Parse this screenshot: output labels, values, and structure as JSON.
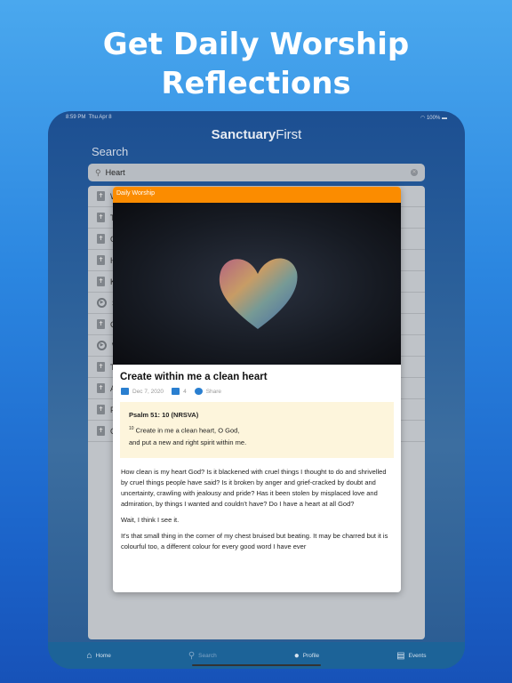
{
  "headline": {
    "line1": "Get Daily Worship",
    "line2": "Reflections"
  },
  "status": {
    "time": "8:59 PM",
    "date": "Thu Apr 8",
    "battery": "100%"
  },
  "app": {
    "logo_bold": "Sanctuary",
    "logo_light": "First"
  },
  "search": {
    "title": "Search",
    "value": "Heart"
  },
  "results": [
    {
      "icon": "bible-icon",
      "letter": "W"
    },
    {
      "icon": "bible-icon",
      "letter": "T"
    },
    {
      "icon": "bible-icon",
      "letter": "G"
    },
    {
      "icon": "bible-icon",
      "letter": "H"
    },
    {
      "icon": "bible-icon",
      "letter": "K"
    },
    {
      "icon": "play-icon",
      "letter": "S"
    },
    {
      "icon": "bible-icon",
      "letter": "C"
    },
    {
      "icon": "play-icon",
      "letter": "W"
    },
    {
      "icon": "bible-icon",
      "letter": "T"
    },
    {
      "icon": "bible-icon",
      "letter": "A"
    },
    {
      "icon": "bible-icon",
      "letter": "F"
    },
    {
      "icon": "bible-icon",
      "letter": "C"
    }
  ],
  "card": {
    "category": "Daily Worship",
    "category_color": "#fb8c00",
    "title": "Create within me a clean heart",
    "date": "Dec 7, 2020",
    "comments": "4",
    "share": "Share",
    "verse": {
      "ref": "Psalm 51: 10 (NRSVA)",
      "num": "10",
      "line1": "Create in me a clean heart, O God,",
      "line2": "and put a new and right spirit within me."
    },
    "paragraphs": [
      "How clean is my heart God? Is it blackened with cruel things I thought to do and shrivelled by cruel things people have said? Is it broken by anger and grief-cracked by doubt and uncertainty, crawling with jealousy and pride? Has it been stolen by misplaced love and admiration, by things I wanted and couldn't have? Do I have a heart at all God?",
      "Wait, I think I see it.",
      "It's that small thing in the corner of my chest bruised but beating. It may be charred but it is colourful too, a different colour for every good word I have ever"
    ]
  },
  "tabs": [
    {
      "label": "Home",
      "icon": "home-icon"
    },
    {
      "label": "Search",
      "icon": "search-icon"
    },
    {
      "label": "Profile",
      "icon": "profile-icon"
    },
    {
      "label": "Events",
      "icon": "events-icon"
    }
  ]
}
